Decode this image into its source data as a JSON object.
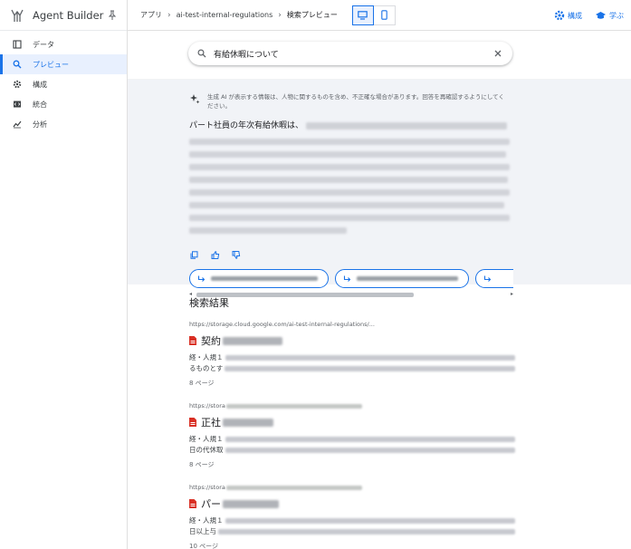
{
  "app": {
    "title": "Agent Builder",
    "accent": "#1a73e8",
    "icons": {
      "logo": "agent-builder-logo",
      "pin": "pin-icon"
    }
  },
  "sidebar": {
    "items": [
      {
        "label": "データ",
        "icon": "data-icon"
      },
      {
        "label": "プレビュー",
        "icon": "search-icon",
        "active": true
      },
      {
        "label": "構成",
        "icon": "gear-icon"
      },
      {
        "label": "統合",
        "icon": "integration-icon"
      },
      {
        "label": "分析",
        "icon": "analytics-icon"
      }
    ]
  },
  "header": {
    "breadcrumb": [
      "アプリ",
      "ai-test-internal-regulations",
      "検索プレビュー"
    ],
    "config_label": "構成",
    "learn_label": "学ぶ"
  },
  "search": {
    "query": "有給休暇について",
    "placeholder": ""
  },
  "ai_overview": {
    "notice": "生成 AI が表示する情報は、人物に関するものを含め、不正確な場合があります。回答を再確認するようにしてください。",
    "summary_lead": "パート社員の年次有給休暇は、"
  },
  "results": {
    "title": "検索結果",
    "items": [
      {
        "url": "https://storage.cloud.google.com/ai-test-internal-regulations/...",
        "title": "契約",
        "snippet_1": "経・人規１",
        "snippet_2": "るものとす",
        "pages": "8 ページ"
      },
      {
        "url": "https://stora",
        "title": "正社",
        "snippet_1": "経・人規１",
        "snippet_2": "日の代休取",
        "pages": "8 ページ"
      },
      {
        "url": "https://stora",
        "title": "パー",
        "snippet_1": "経・人規１",
        "snippet_2": "日以上与",
        "pages": "10 ページ"
      }
    ]
  }
}
